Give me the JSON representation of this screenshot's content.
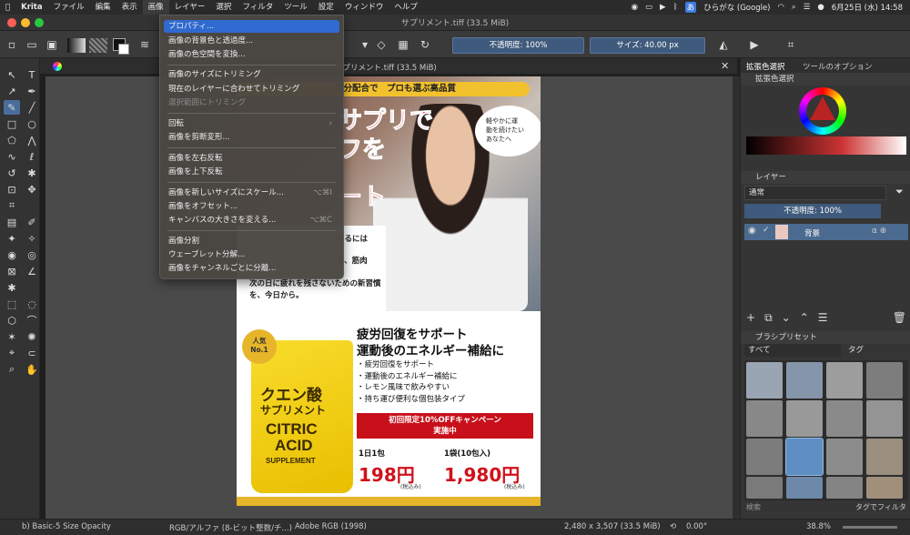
{
  "menubar": {
    "app": "Krita",
    "items": [
      "ファイル",
      "編集",
      "表示",
      "画像",
      "レイヤー",
      "選択",
      "フィルタ",
      "ツール",
      "設定",
      "ウィンドウ",
      "ヘルプ"
    ],
    "input_badge": "あ",
    "input_method": "ひらがな (Google)",
    "datetime": "6月25日 (水)  14:58"
  },
  "window_title": "サプリメント.tiff (33.5 MiB)",
  "tool_options": {
    "opacity": "不透明度: 100%",
    "size": "サイズ: 40.00 px"
  },
  "document_tab": "サプリメント.tiff (33.5 MiB)",
  "image_menu": {
    "items": [
      {
        "label": "プロパティ...",
        "shortcut": "",
        "state": "highlighted"
      },
      {
        "label": "画像の背景色と透過度...",
        "shortcut": "",
        "state": "normal"
      },
      {
        "label": "画像の色空間を変換...",
        "shortcut": "",
        "state": "normal"
      },
      {
        "label": "画像のサイズにトリミング",
        "shortcut": "",
        "state": "normal"
      },
      {
        "label": "現在のレイヤーに合わせてトリミング",
        "shortcut": "",
        "state": "normal"
      },
      {
        "label": "選択範囲にトリミング",
        "shortcut": "",
        "state": "disabled"
      },
      {
        "label": "回転",
        "shortcut": "›",
        "state": "normal"
      },
      {
        "label": "画像を剪断変形...",
        "shortcut": "",
        "state": "normal"
      },
      {
        "label": "画像を左右反転",
        "shortcut": "",
        "state": "normal"
      },
      {
        "label": "画像を上下反転",
        "shortcut": "",
        "state": "normal"
      },
      {
        "label": "画像を新しいサイズにスケール...",
        "shortcut": "⌥⌘I",
        "state": "normal"
      },
      {
        "label": "画像をオフセット...",
        "shortcut": "",
        "state": "normal"
      },
      {
        "label": "キャンバスの大きさを変える...",
        "shortcut": "⌥⌘C",
        "state": "normal"
      },
      {
        "label": "画像分割",
        "shortcut": "",
        "state": "normal"
      },
      {
        "label": "ウェーブレット分解...",
        "shortcut": "",
        "state": "normal"
      },
      {
        "label": "画像をチャンネルごとに分離...",
        "shortcut": "",
        "state": "normal"
      }
    ]
  },
  "poster": {
    "top_banner": "成分配合で　プロも選ぶ高品質",
    "headline_line1": "サプリで",
    "headline_line2": "フを",
    "headline_line3": "ート",
    "speech_bubble": "軽やかに運\n動を続けたい\nあなたへ",
    "body_text_1": "けるには",
    "body_text_2": "で、筋肉",
    "body_text_3": "次の日に疲れを残さないための新習慣を、今日から。",
    "popular_badge_line1": "人気",
    "popular_badge_line2": "No.1",
    "pack_name_jp": "クエン酸",
    "pack_sub_jp": "サプリメント",
    "pack_name_en1": "CITRIC",
    "pack_name_en2": "ACID",
    "pack_sub_en": "SUPPLEMENT",
    "main_heading_1": "疲労回復をサポート",
    "main_heading_2": "運動後のエネルギー補給に",
    "bullets": [
      "・疲労回復をサポート",
      "・運動後のエネルギー補給に",
      "・レモン風味で飲みやすい",
      "・持ち運び便利な個包装タイプ"
    ],
    "campaign_line1": "初回限定10%OFFキャンペーン",
    "campaign_line2": "実施中",
    "price1_label": "1日1包",
    "price1_value": "198円",
    "price1_tax": "(税込み)",
    "price2_label": "1袋(10包入)",
    "price2_value": "1,980円",
    "price2_tax": "(税込み)"
  },
  "docker": {
    "tab_color": "拡張色選択",
    "tab_tool_options": "ツールのオプション",
    "color_title": "拡張色選択",
    "layers_title": "レイヤー",
    "blend_mode": "通常",
    "layer_opacity": "不透明度: 100%",
    "layer_name": "背景",
    "presets_title": "ブラシプリセット",
    "preset_filter": "すべて",
    "tag_label": "タグ",
    "search_placeholder": "検索",
    "tag_filter": "タグでフィルタ"
  },
  "status": {
    "brush": "b) Basic-5 Size Opacity",
    "color_model": "RGB/アルファ (8-ビット整数/チ...)",
    "profile": "Adobe RGB (1998)",
    "dimensions": "2,480 x 3,507 (33.5 MiB)",
    "rotation": "0.00°",
    "zoom": "38.8%"
  },
  "colors": {
    "accent": "#2f6ad0",
    "poster_yellow": "#f2c12e",
    "poster_red": "#d0111b"
  }
}
